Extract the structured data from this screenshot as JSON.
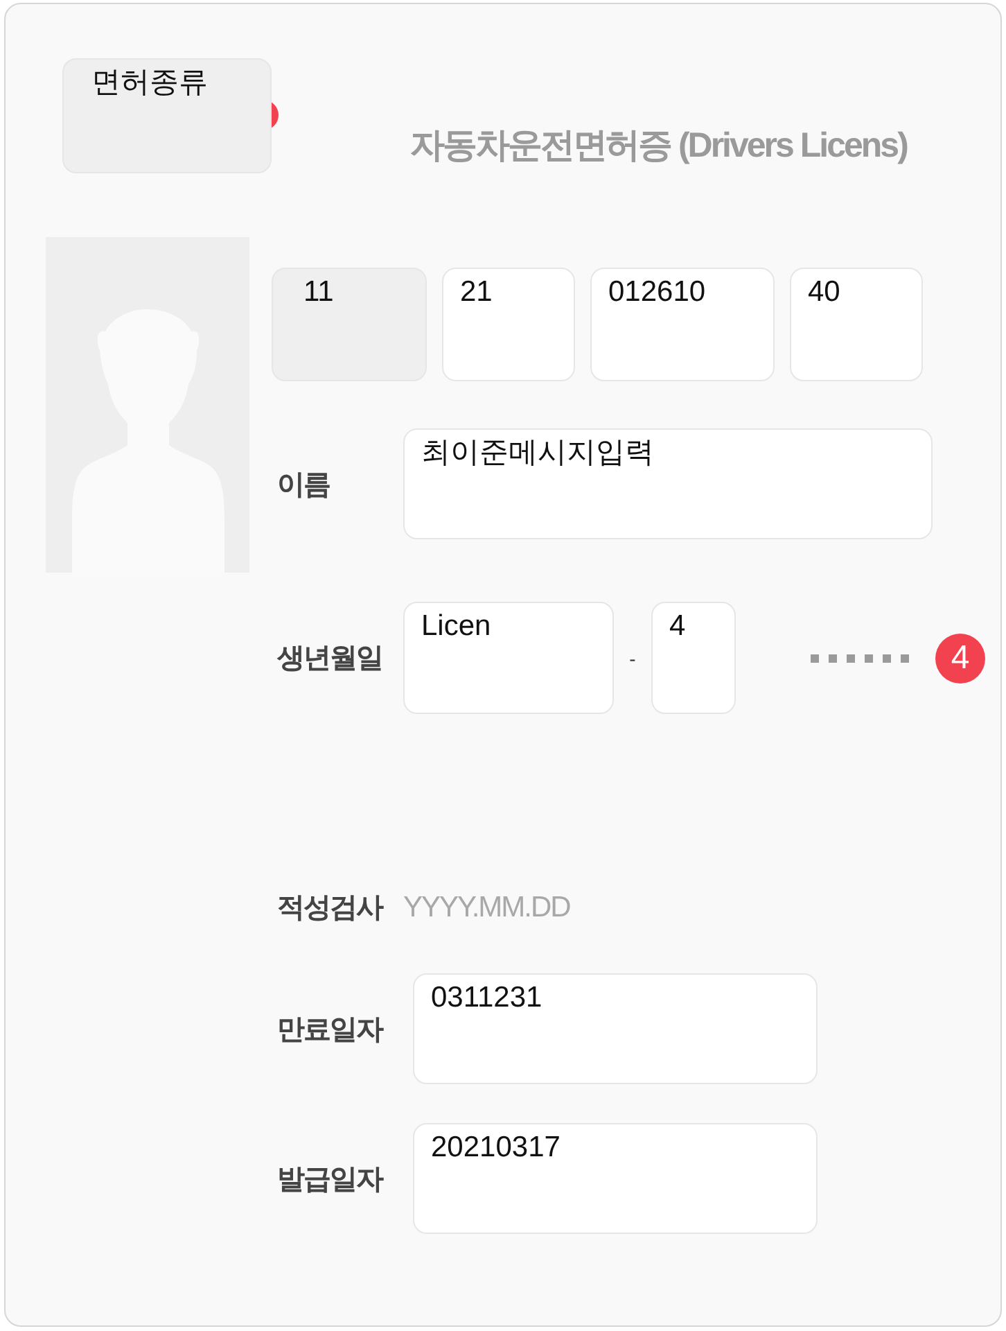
{
  "license_type": {
    "value": "면허종류",
    "disabled": true
  },
  "title": "자동차운전면허증 (Drivers Licens)",
  "number_fields": [
    {
      "value": "11",
      "disabled": true
    },
    {
      "value": "21",
      "disabled": false
    },
    {
      "value": "012610",
      "disabled": false
    },
    {
      "value": "40",
      "disabled": false
    }
  ],
  "name": {
    "label": "이름",
    "value": "최이준메시지입력"
  },
  "birth": {
    "label": "생년월일",
    "first": "Licen",
    "separator": "-",
    "second": "4",
    "badge": "4"
  },
  "aptitude": {
    "label": "적성검사",
    "hint": "YYYY.MM.DD"
  },
  "expiry": {
    "label": "만료일자",
    "value": "0311231"
  },
  "issue": {
    "label": "발급일자",
    "value": "20210317"
  }
}
